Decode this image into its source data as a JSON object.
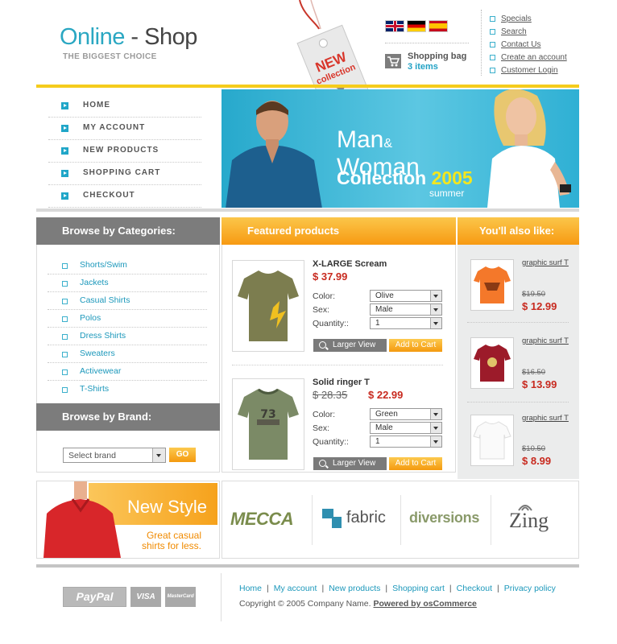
{
  "header": {
    "logo_part1": "Online",
    "logo_dash": "-",
    "logo_part2": "Shop",
    "tagline": "THE BIGGEST CHOICE",
    "tag_line1": "NEW",
    "tag_line2": "collection",
    "flags": [
      "flag-uk-icon",
      "flag-germany-icon",
      "flag-spain-icon"
    ],
    "cart_title": "Shopping bag",
    "cart_items": "3 items",
    "links": [
      "Specials",
      "Search",
      "Contact Us",
      "Create an account",
      "Customer Login"
    ]
  },
  "nav": {
    "items": [
      "HOME",
      "MY ACCOUNT",
      "NEW PRODUCTS",
      "SHOPPING CART",
      "CHECKOUT"
    ]
  },
  "banner": {
    "line1_a": "Man",
    "line1_amp": "&",
    "line1_b": "Woman",
    "line2": "Collection",
    "year": "2005",
    "season": "summer"
  },
  "categories": {
    "title": "Browse by Categories:",
    "items": [
      "Shorts/Swim",
      "Jackets",
      "Casual Shirts",
      "Polos",
      "Dress Shirts",
      "Sweaters",
      "Activewear",
      "T-Shirts"
    ]
  },
  "brand_browse": {
    "title": "Browse by Brand:",
    "select_value": "Select brand",
    "go_label": "GO"
  },
  "featured": {
    "title": "Featured products",
    "color_label": "Color:",
    "sex_label": "Sex:",
    "qty_label": "Quantity::",
    "larger_label": "Larger View",
    "cart_label": "Add to Cart",
    "products": [
      {
        "name": "X-LARGE Scream",
        "old_price": "",
        "price": "$ 37.99",
        "color": "Olive",
        "sex": "Male",
        "qty": "1"
      },
      {
        "name": "Solid ringer T",
        "old_price": "$ 28.35",
        "price": "$ 22.99",
        "color": "Green",
        "sex": "Male",
        "qty": "1"
      }
    ]
  },
  "also_like": {
    "title": "You'll also like:",
    "items": [
      {
        "name": "graphic surf T",
        "old_price": "$19.50",
        "price": "$ 12.99",
        "color": "#f4782a"
      },
      {
        "name": "graphic surf T",
        "old_price": "$16.50",
        "price": "$ 13.99",
        "color": "#9c1b2a"
      },
      {
        "name": "graphic surf T",
        "old_price": "$10.50",
        "price": "$ 8.99",
        "color": "#f4f4f4"
      }
    ]
  },
  "ad": {
    "title": "New Style",
    "sub1": "Great casual",
    "sub2": "shirts for less."
  },
  "brands": [
    "MECCA",
    "fabric",
    "diversions",
    "Zing"
  ],
  "footer": {
    "payments": [
      "PayPal",
      "VISA",
      "MasterCard"
    ],
    "links": [
      "Home",
      "My account",
      "New products",
      "Shopping cart",
      "Checkout",
      "Privacy policy"
    ],
    "separator": "|",
    "copyright": "Copyright © 2005 Company Name.",
    "powered": "Powered by osCommerce"
  },
  "colors": {
    "accent_blue": "#22a2c5",
    "accent_orange": "#f79a12",
    "accent_yellow": "#f5cc1c",
    "price_red": "#c82a1f",
    "header_grey": "#7c7c7c"
  }
}
